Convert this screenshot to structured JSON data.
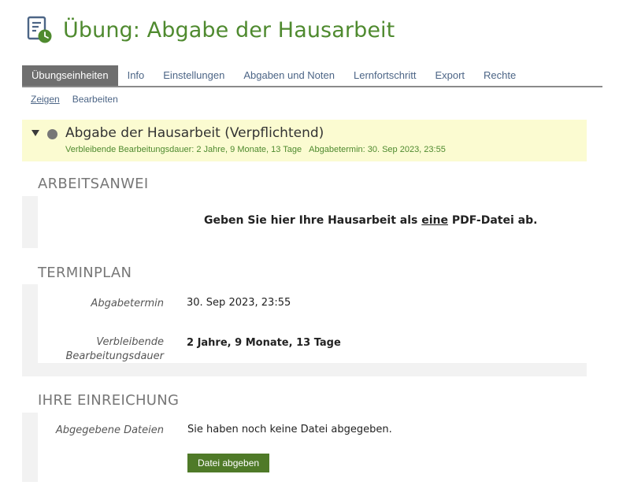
{
  "header": {
    "title": "Übung: Abgabe der Hausarbeit",
    "icon": "exercise-document-clock-icon"
  },
  "tabs": [
    {
      "label": "Übungseinheiten",
      "active": true
    },
    {
      "label": "Info"
    },
    {
      "label": "Einstellungen"
    },
    {
      "label": "Abgaben und Noten"
    },
    {
      "label": "Lernfortschritt"
    },
    {
      "label": "Export"
    },
    {
      "label": "Rechte"
    }
  ],
  "subtabs": [
    {
      "label": "Zeigen",
      "active": true
    },
    {
      "label": "Bearbeiten"
    }
  ],
  "assignment": {
    "title": "Abgabe der Hausarbeit (Verpflichtend)",
    "remaining": "Verbleibende Bearbeitungsdauer: 2 Jahre, 9 Monate, 13 Tage",
    "deadline": "Abgabetermin: 30. Sep 2023, 23:55"
  },
  "instructions": {
    "heading": "ARBEITSANWEI",
    "text_before": "Geben Sie hier Ihre Hausarbeit als ",
    "text_underlined": "eine",
    "text_after": " PDF-Datei ab."
  },
  "schedule": {
    "heading": "TERMINPLAN",
    "deadline_label": "Abgabetermin",
    "deadline_value": "30. Sep 2023, 23:55",
    "remaining_label_1": "Verbleibende",
    "remaining_label_2": "Bearbeitungsdauer",
    "remaining_value": "2 Jahre, 9 Monate, 13 Tage"
  },
  "submission": {
    "heading": "IHRE EINREICHUNG",
    "files_label": "Abgegebene Dateien",
    "files_value": "Sie haben noch keine Datei abgegeben.",
    "submit_button": "Datei abgeben"
  },
  "colors": {
    "brand_green": "#4f8a2f",
    "button_green": "#4f7a28",
    "highlight_yellow": "#fbfbd1",
    "active_tab": "#6f6f6f",
    "link": "#4c6586"
  }
}
